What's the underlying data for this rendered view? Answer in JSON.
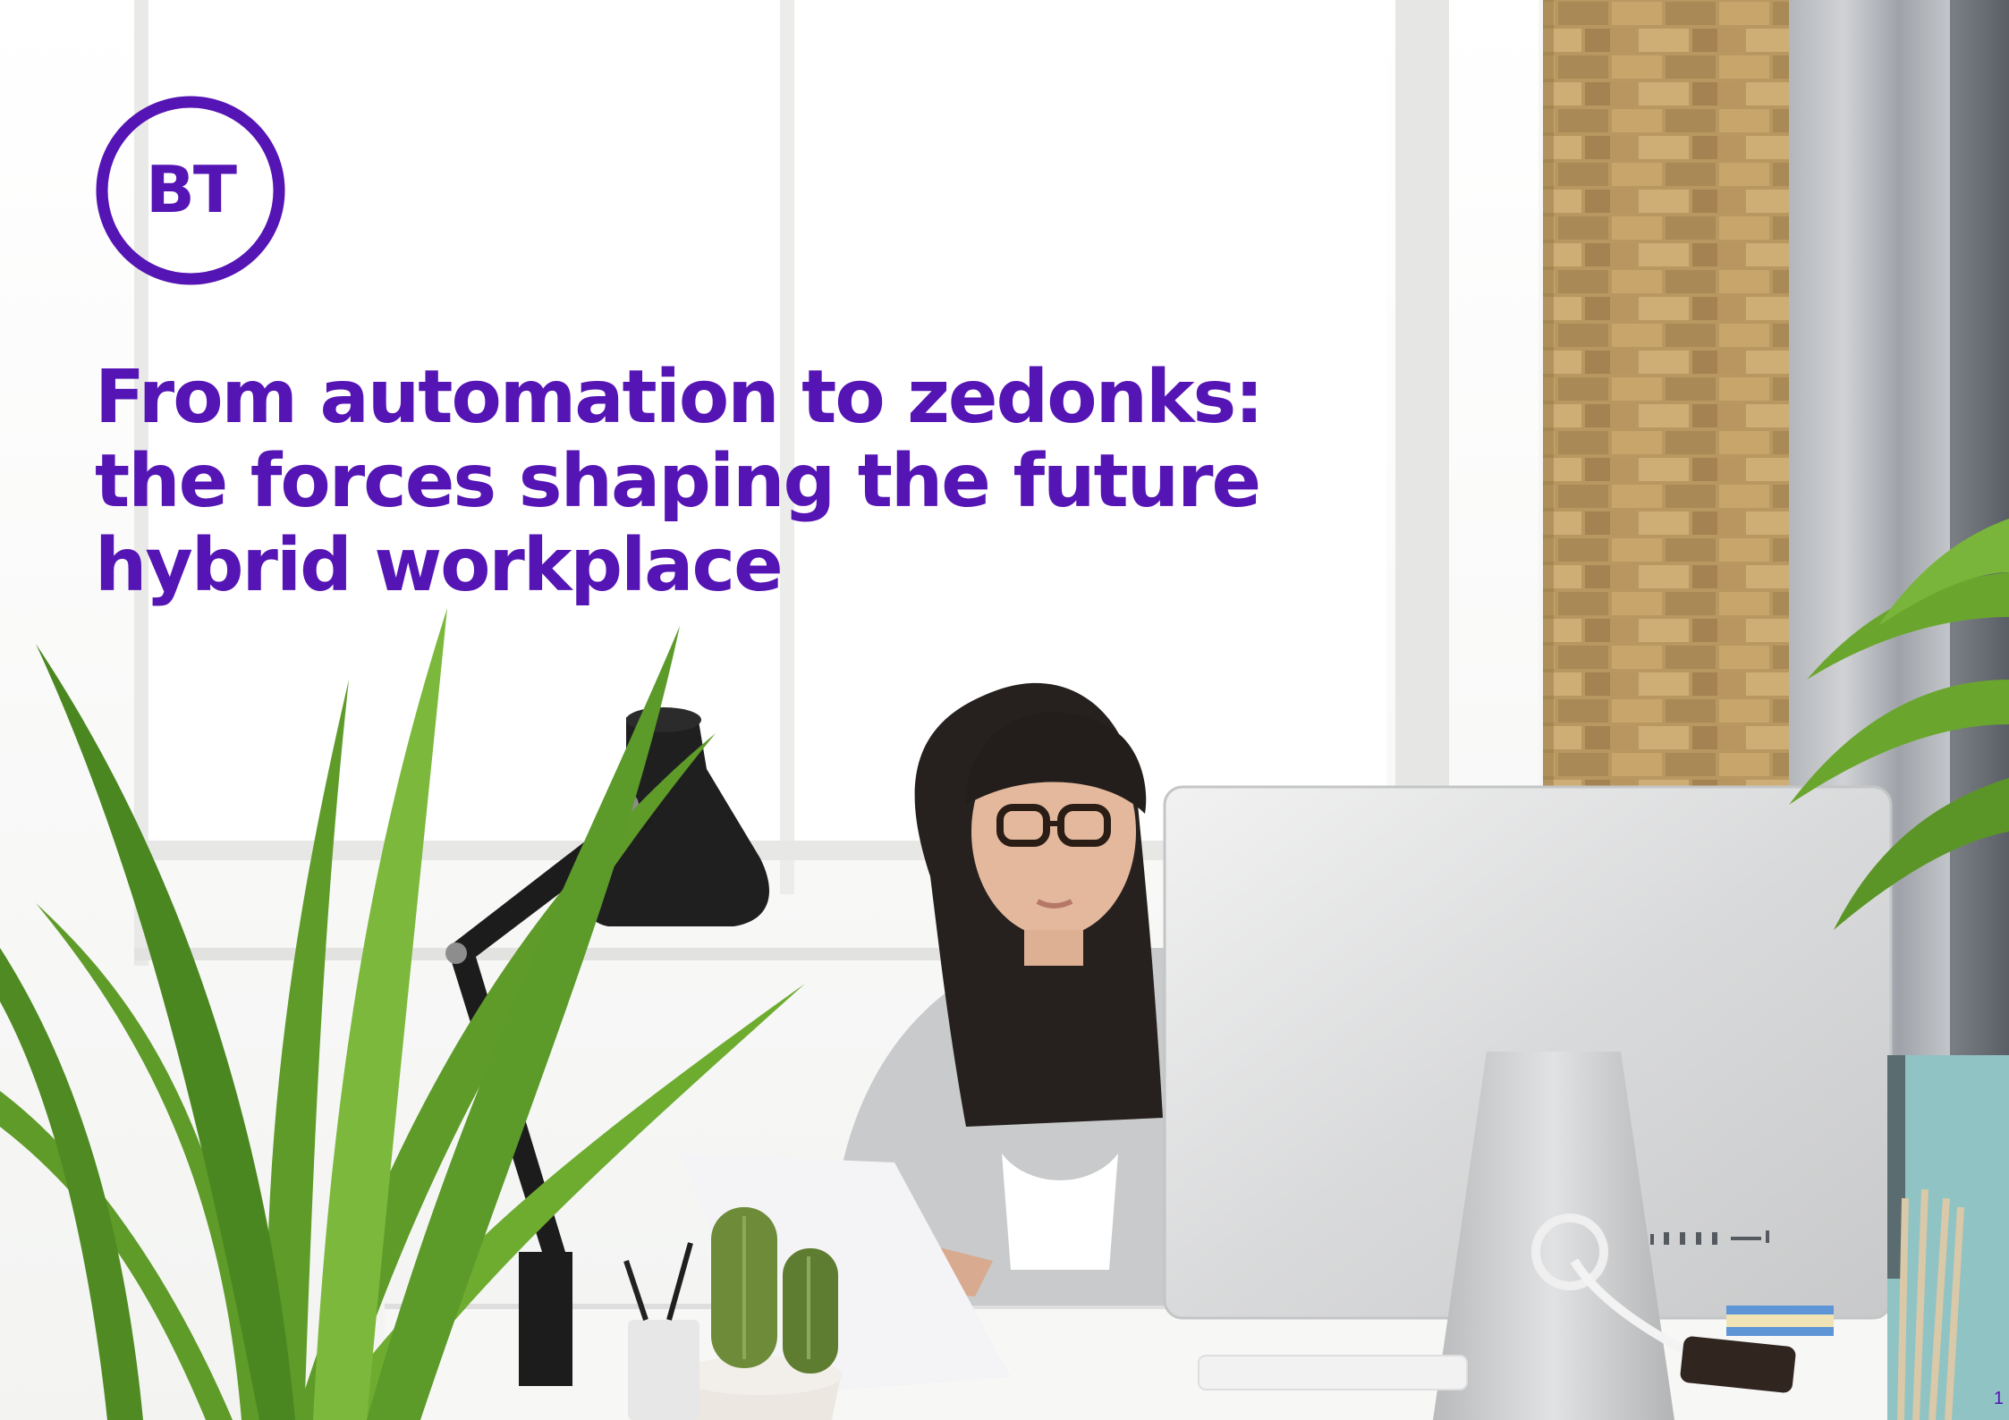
{
  "brand": {
    "logo_text": "BT",
    "color": "#5514b4"
  },
  "cover": {
    "title_lines": [
      "From automation to zedonks:",
      "the forces shaping the future",
      "hybrid workplace"
    ]
  },
  "footer": {
    "page_number": "1"
  },
  "colors": {
    "accent": "#5514b4",
    "background": "#f6f6f4"
  }
}
